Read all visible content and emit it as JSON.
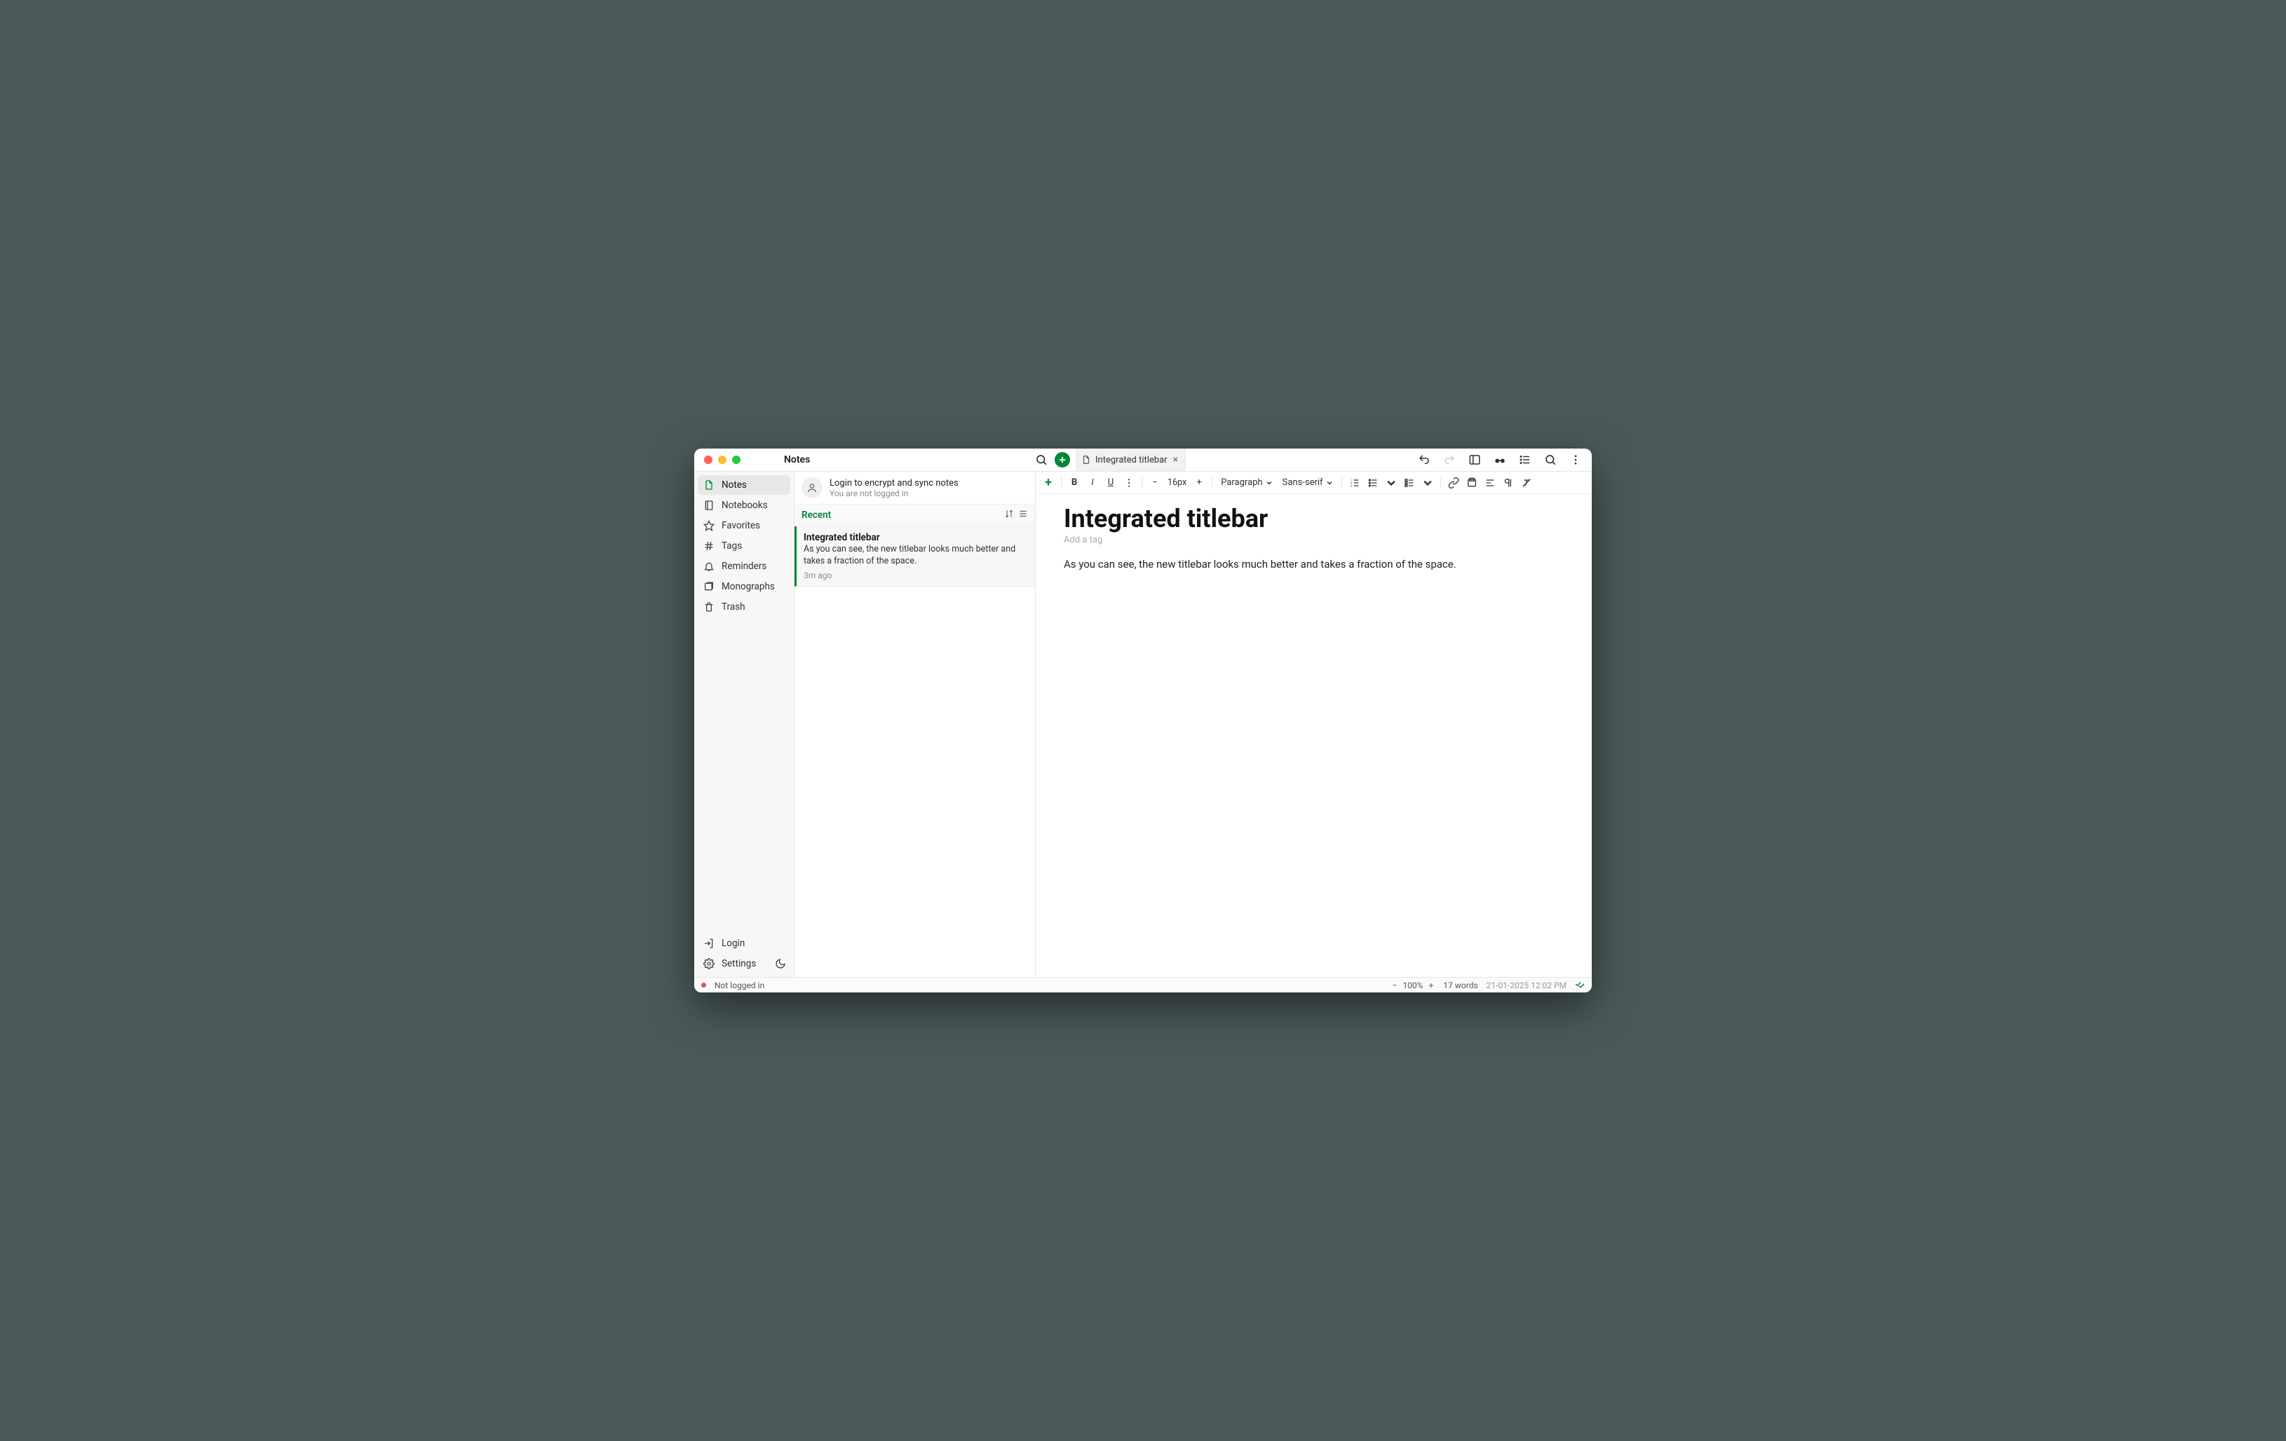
{
  "titlebar": {
    "title": "Notes",
    "tab_label": "Integrated titlebar"
  },
  "sidebar": {
    "items": [
      {
        "label": "Notes"
      },
      {
        "label": "Notebooks"
      },
      {
        "label": "Favorites"
      },
      {
        "label": "Tags"
      },
      {
        "label": "Reminders"
      },
      {
        "label": "Monographs"
      },
      {
        "label": "Trash"
      }
    ],
    "login_label": "Login",
    "settings_label": "Settings"
  },
  "notelist": {
    "login_line1": "Login to encrypt and sync notes",
    "login_line2": "You are not logged in",
    "filter_label": "Recent",
    "entries": [
      {
        "title": "Integrated titlebar",
        "preview": "As you can see, the new titlebar looks much better and takes a fraction of the space.",
        "time": "3m ago"
      }
    ]
  },
  "editor": {
    "title": "Integrated titlebar",
    "tag_placeholder": "Add a tag",
    "body": "As you can see, the new titlebar looks much better and takes a fraction of the space.",
    "font_size": "16px",
    "paragraph_label": "Paragraph",
    "font_family_label": "Sans-serif"
  },
  "statusbar": {
    "login_status": "Not logged in",
    "zoom": "100%",
    "word_count": "17 words",
    "datetime": "21-01-2025 12:02 PM"
  }
}
